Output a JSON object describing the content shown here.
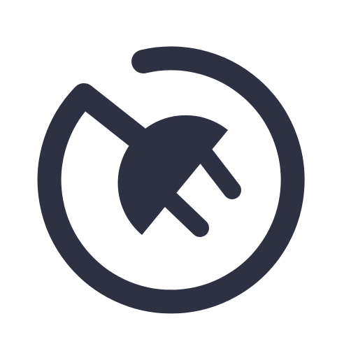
{
  "icon": {
    "name": "plug-power-icon",
    "color": "#2d3142",
    "background": "#ffffff"
  }
}
